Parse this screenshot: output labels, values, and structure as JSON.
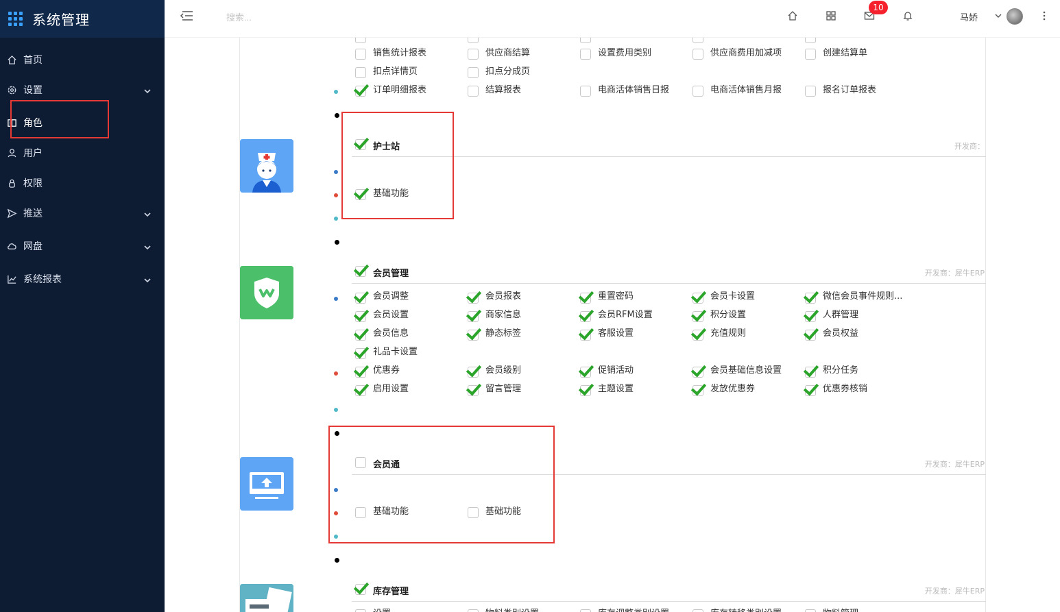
{
  "app": {
    "title": "系统管理"
  },
  "sidebar": {
    "items": [
      {
        "label": "首页",
        "icon": "home-icon"
      },
      {
        "label": "设置",
        "icon": "gear-icon",
        "expandable": true
      },
      {
        "label": "角色",
        "icon": "role-icon",
        "active": true
      },
      {
        "label": "用户",
        "icon": "user-icon"
      },
      {
        "label": "权限",
        "icon": "lock-icon"
      },
      {
        "label": "推送",
        "icon": "send-icon",
        "expandable": true
      },
      {
        "label": "网盘",
        "icon": "cloud-icon",
        "expandable": true
      },
      {
        "label": "系统报表",
        "icon": "chart-icon",
        "expandable": true
      }
    ]
  },
  "topbar": {
    "search_placeholder": "搜索...",
    "mail_badge": "10",
    "user_name": "马娇"
  },
  "content": {
    "top_section": {
      "rows": [
        [
          "销售统计报表",
          "供应商结算",
          "设置费用类别",
          "供应商费用加减项",
          "创建结算单"
        ],
        [
          "扣点详情页",
          "扣点分成页"
        ],
        [
          "订单明细报表",
          "结算报表",
          "电商活体销售日报",
          "电商活体销售月报",
          "报名订单报表"
        ]
      ],
      "checked": [
        [
          false,
          false,
          false,
          false,
          false
        ],
        [
          false,
          false
        ],
        [
          true,
          false,
          false,
          false,
          false
        ]
      ]
    },
    "nurse": {
      "title": "护士站",
      "developer": "开发商：",
      "checked": true,
      "items": [
        {
          "label": "基础功能",
          "checked": true
        }
      ]
    },
    "member": {
      "title": "会员管理",
      "developer": "开发商：犀牛ERP",
      "checked": true,
      "rows": [
        [
          "会员调整",
          "会员报表",
          "重置密码",
          "会员卡设置",
          "微信会员事件规则..."
        ],
        [
          "会员设置",
          "商家信息",
          "会员RFM设置",
          "积分设置",
          "人群管理"
        ],
        [
          "会员信息",
          "静态标签",
          "客服设置",
          "充值规则",
          "会员权益"
        ],
        [
          "礼品卡设置"
        ],
        [
          "优惠券",
          "会员级别",
          "促销活动",
          "会员基础信息设置",
          "积分任务"
        ],
        [
          "启用设置",
          "留言管理",
          "主题设置",
          "发放优惠券",
          "优惠券核销"
        ]
      ]
    },
    "member_link": {
      "title": "会员通",
      "developer": "开发商：犀牛ERP",
      "checked": false,
      "items": [
        {
          "label": "基础功能",
          "checked": false
        },
        {
          "label": "基础功能",
          "checked": false
        }
      ]
    },
    "inventory": {
      "title": "库存管理",
      "developer": "开发商：犀牛ERP",
      "checked": true,
      "items": [
        "设置",
        "物料类别设置",
        "库存调整类别设置",
        "库存转移类别设置",
        "物料管理"
      ]
    }
  }
}
